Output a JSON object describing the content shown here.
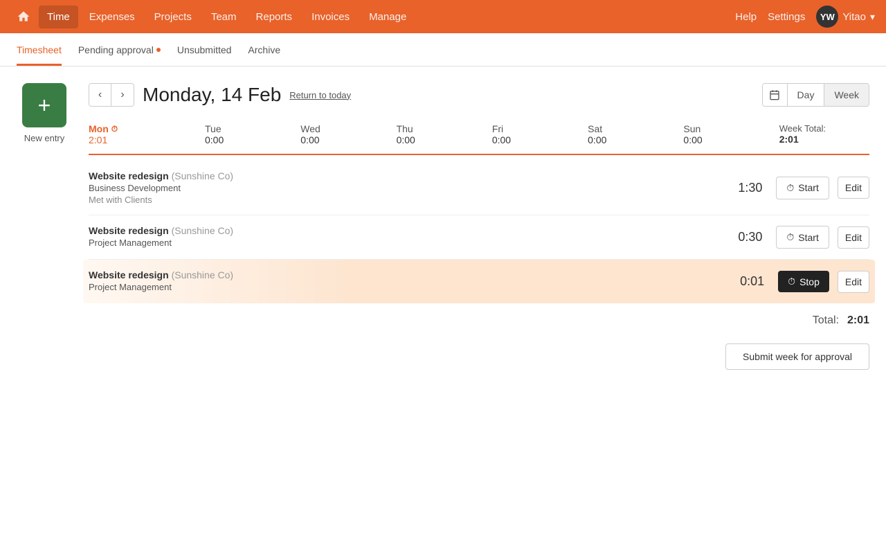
{
  "brand": {
    "color": "#E8622A"
  },
  "topnav": {
    "home_icon": "🏠",
    "items": [
      {
        "label": "Time",
        "active": true
      },
      {
        "label": "Expenses"
      },
      {
        "label": "Projects"
      },
      {
        "label": "Team"
      },
      {
        "label": "Reports"
      },
      {
        "label": "Invoices"
      },
      {
        "label": "Manage"
      }
    ],
    "help_label": "Help",
    "settings_label": "Settings",
    "avatar_initials": "YW",
    "user_name": "Yitao",
    "chevron": "▾"
  },
  "subnav": {
    "items": [
      {
        "label": "Timesheet",
        "active": true,
        "dot": false
      },
      {
        "label": "Pending approval",
        "active": false,
        "dot": true
      },
      {
        "label": "Unsubmitted",
        "active": false,
        "dot": false
      },
      {
        "label": "Archive",
        "active": false,
        "dot": false
      }
    ]
  },
  "sidebar": {
    "new_entry_icon": "+",
    "new_entry_label": "New entry"
  },
  "date_nav": {
    "prev_icon": "‹",
    "next_icon": "›",
    "date_title": "Monday, 14 Feb",
    "return_to_today": "Return to today",
    "calendar_icon": "📅",
    "view_day": "Day",
    "view_week": "Week"
  },
  "week_row": {
    "days": [
      {
        "label": "Mon",
        "hours": "2:01",
        "active": true
      },
      {
        "label": "Tue",
        "hours": "0:00",
        "active": false
      },
      {
        "label": "Wed",
        "hours": "0:00",
        "active": false
      },
      {
        "label": "Thu",
        "hours": "0:00",
        "active": false
      },
      {
        "label": "Fri",
        "hours": "0:00",
        "active": false
      },
      {
        "label": "Sat",
        "hours": "0:00",
        "active": false
      },
      {
        "label": "Sun",
        "hours": "0:00",
        "active": false
      }
    ],
    "total_label": "Week Total:",
    "total_hours": "2:01"
  },
  "entries": [
    {
      "id": 1,
      "project": "Website redesign",
      "client": "(Sunshine Co)",
      "category": "Business Development",
      "note": "Met with Clients",
      "time": "1:30",
      "active": false
    },
    {
      "id": 2,
      "project": "Website redesign",
      "client": "(Sunshine Co)",
      "category": "Project Management",
      "note": "",
      "time": "0:30",
      "active": false
    },
    {
      "id": 3,
      "project": "Website redesign",
      "client": "(Sunshine Co)",
      "category": "Project Management",
      "note": "",
      "time": "0:01",
      "active": true
    }
  ],
  "total": {
    "label": "Total:",
    "value": "2:01"
  },
  "submit_btn_label": "Submit week for approval",
  "buttons": {
    "start_label": "Start",
    "stop_label": "Stop",
    "edit_label": "Edit",
    "clock_icon": "⏱"
  }
}
